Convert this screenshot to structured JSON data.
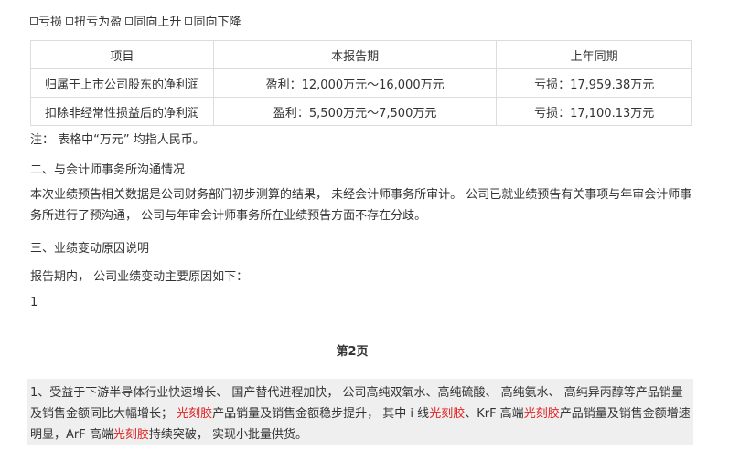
{
  "checkboxes": [
    {
      "label": "亏损"
    },
    {
      "label": "扭亏为盈"
    },
    {
      "label": "同向上升"
    },
    {
      "label": "同向下降"
    }
  ],
  "table": {
    "headers": [
      "项目",
      "本报告期",
      "上年同期"
    ],
    "rows": [
      [
        "归属于上市公司股东的净利润",
        "盈利：12,000万元～16,000万元",
        "亏损：17,959.38万元"
      ],
      [
        "扣除非经常性损益后的净利润",
        "盈利：5,500万元～7,500万元",
        "亏损：17,100.13万元"
      ]
    ]
  },
  "note": "注： 表格中“万元” 均指人民币。",
  "section2_title": "二、与会计师事务所沟通情况",
  "section2_body": "本次业绩预告相关数据是公司财务部门初步测算的结果， 未经会计师事务所审计。 公司已就业绩预告有关事项与年审会计师事务所进行了预沟通， 公司与年审会计师事务所在业绩预告方面不存在分歧。",
  "section3_title": "三、业绩变动原因说明",
  "section3_intro": "报告期内， 公司业绩变动主要原因如下：",
  "page_number": "1",
  "page_label": "第2页",
  "reason": {
    "p1": "1、受益于下游半导体行业快速增长、 国产替代进程加快， 公司高纯双氧水、高纯硫酸、 高纯氨水、 高纯异丙醇等产品销量及销售金额同比大幅增长；",
    "hl1": "光刻胶",
    "p2": "产品销量及销售金额稳步提升， 其中 i 线",
    "hl2": "光刻胶",
    "p3": "、KrF 高端",
    "hl3": "光刻胶",
    "p4": "产品销量及销售金额增速明显，ArF 高端",
    "hl4": "光刻胶",
    "p5": "持续突破， 实现小批量供货。"
  },
  "colors": {
    "highlight": "#e02020",
    "block_bg": "#efefef",
    "border": "#dcdcdc"
  }
}
